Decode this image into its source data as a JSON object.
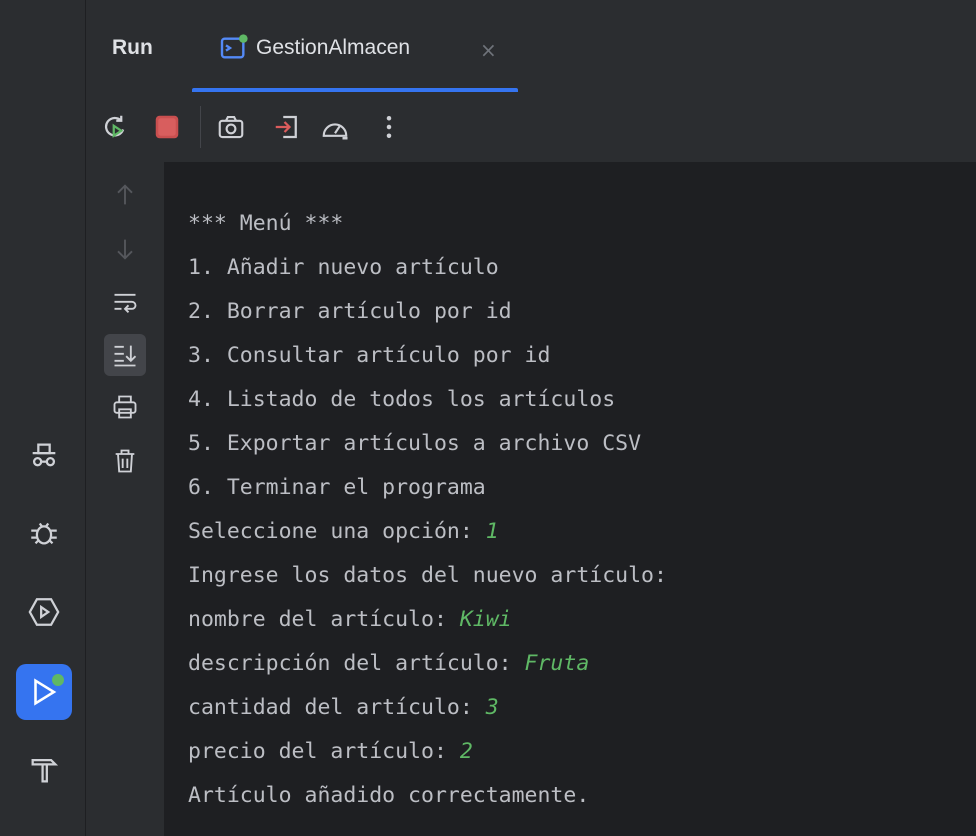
{
  "tab_bar": {
    "run_label": "Run",
    "tab_title": "GestionAlmacen",
    "close_glyph": "×"
  },
  "console": {
    "lines": [
      {
        "text": "*** Menú ***",
        "input": ""
      },
      {
        "text": "1. Añadir nuevo artículo",
        "input": ""
      },
      {
        "text": "2. Borrar artículo por id",
        "input": ""
      },
      {
        "text": "3. Consultar artículo por id",
        "input": ""
      },
      {
        "text": "4. Listado de todos los artículos",
        "input": ""
      },
      {
        "text": "5. Exportar artículos a archivo CSV",
        "input": ""
      },
      {
        "text": "6. Terminar el programa",
        "input": ""
      },
      {
        "text": "Seleccione una opción: ",
        "input": "1"
      },
      {
        "text": "Ingrese los datos del nuevo artículo:",
        "input": ""
      },
      {
        "text": "nombre del artículo: ",
        "input": "Kiwi"
      },
      {
        "text": "descripción del artículo: ",
        "input": "Fruta"
      },
      {
        "text": "cantidad del artículo: ",
        "input": "3"
      },
      {
        "text": "precio del artículo: ",
        "input": "2"
      },
      {
        "text": "Artículo añadido correctamente.",
        "input": ""
      }
    ]
  },
  "colors": {
    "accent": "#3574f0",
    "input_green": "#5fb865",
    "stop_red": "#c94f4f"
  }
}
